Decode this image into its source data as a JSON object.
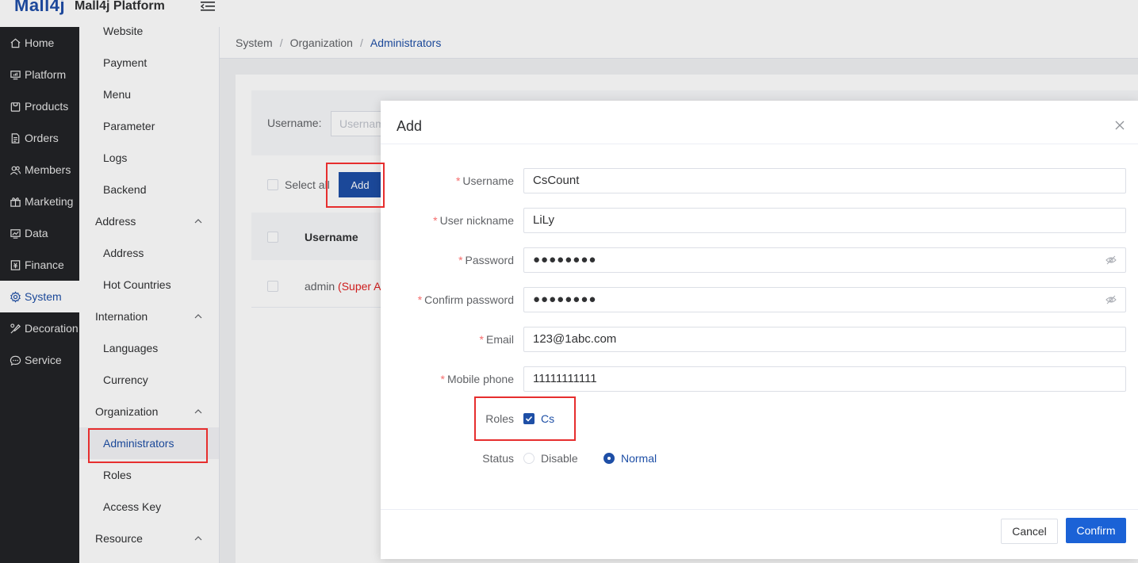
{
  "app": {
    "logo": "Mall4j",
    "title": "Mall4j Platform"
  },
  "nav": {
    "items": [
      {
        "label": "Home",
        "icon": "home-icon"
      },
      {
        "label": "Platform",
        "icon": "platform-icon"
      },
      {
        "label": "Products",
        "icon": "products-icon"
      },
      {
        "label": "Orders",
        "icon": "orders-icon"
      },
      {
        "label": "Members",
        "icon": "members-icon"
      },
      {
        "label": "Marketing",
        "icon": "marketing-icon"
      },
      {
        "label": "Data",
        "icon": "data-icon"
      },
      {
        "label": "Finance",
        "icon": "finance-icon"
      },
      {
        "label": "System",
        "icon": "gear-icon",
        "active": true
      },
      {
        "label": "Decoration",
        "icon": "decoration-icon"
      },
      {
        "label": "Service",
        "icon": "chat-icon"
      }
    ]
  },
  "submenu": {
    "website": "Website",
    "payment": "Payment",
    "menu": "Menu",
    "parameter": "Parameter",
    "logs": "Logs",
    "backend": "Backend",
    "address_group": "Address",
    "address": "Address",
    "hot_countries": "Hot Countries",
    "internation_group": "Internation",
    "languages": "Languages",
    "currency": "Currency",
    "organization_group": "Organization",
    "administrators": "Administrators",
    "roles": "Roles",
    "access_key": "Access Key",
    "resource_group": "Resource"
  },
  "breadcrumb": {
    "items": [
      "System",
      "Organization",
      "Administrators"
    ],
    "separator": "/"
  },
  "list": {
    "search_label": "Username:",
    "search_placeholder": "Usernam",
    "select_all": "Select all",
    "add_button": "Add",
    "col_username": "Username",
    "row_username": "admin",
    "row_tag": "(Super A"
  },
  "dialog": {
    "title": "Add",
    "fields": {
      "username": {
        "label": "Username",
        "value": "CsCount"
      },
      "nickname": {
        "label": "User nickname",
        "value": "LiLy"
      },
      "password": {
        "label": "Password",
        "value": "●●●●●●●●"
      },
      "confirm": {
        "label": "Confirm password",
        "value": "●●●●●●●●"
      },
      "email": {
        "label": "Email",
        "value": "123@1abc.com"
      },
      "mobile": {
        "label": "Mobile phone",
        "value": "11111111111"
      }
    },
    "roles": {
      "label": "Roles",
      "option": "Cs",
      "checked": true
    },
    "status": {
      "label": "Status",
      "options": [
        "Disable",
        "Normal"
      ],
      "selected": "Normal"
    },
    "cancel": "Cancel",
    "confirm_btn": "Confirm"
  },
  "colors": {
    "primary": "#1e4fa6",
    "confirm": "#1b62d6",
    "nav_bg": "#222326",
    "required": "#f56c6c",
    "highlight": "#e62e2e"
  }
}
